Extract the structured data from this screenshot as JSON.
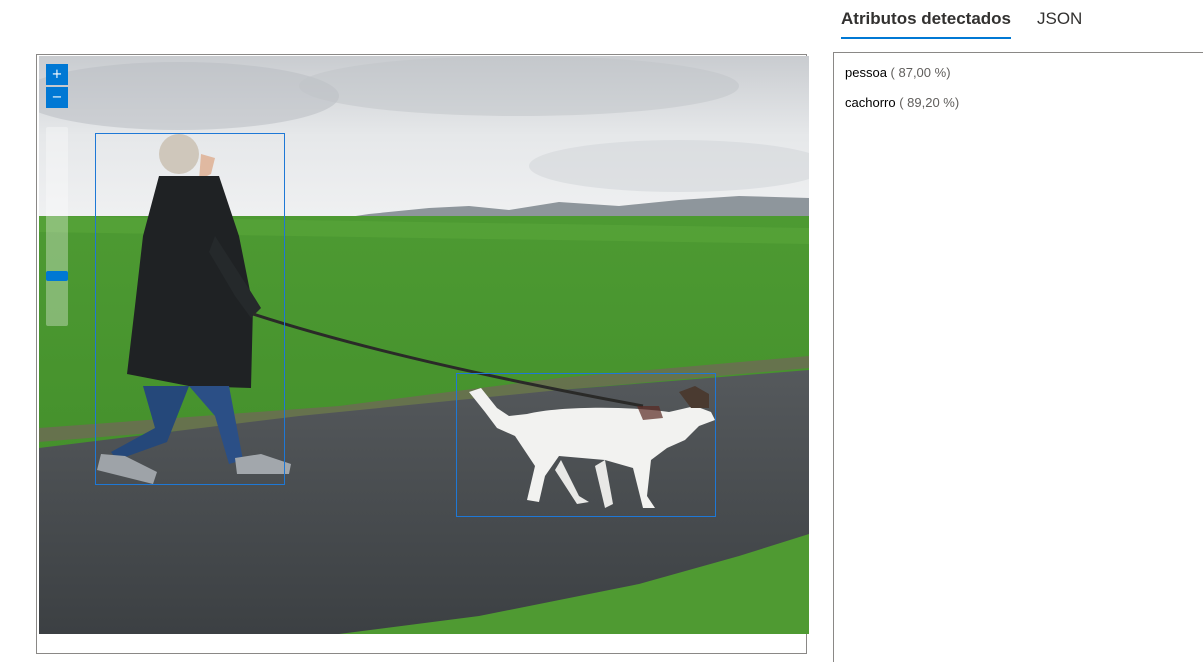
{
  "tabs": [
    {
      "label": "Atributos detectados",
      "active": true
    },
    {
      "label": "JSON",
      "active": false
    }
  ],
  "viewer": {
    "zoom_in_label": "+",
    "zoom_out_label": "−",
    "zoom_level": 0.15
  },
  "detections": [
    {
      "name": "pessoa",
      "confidence": "( 87,00 %)"
    },
    {
      "name": "cachorro",
      "confidence": "( 89,20 %)"
    }
  ],
  "colors": {
    "accent": "#0078d4",
    "bbox": "#1e78d6"
  }
}
